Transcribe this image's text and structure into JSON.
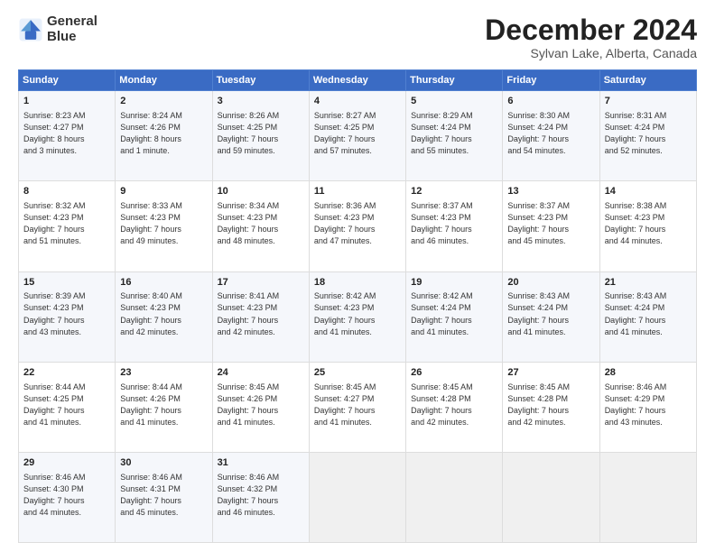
{
  "header": {
    "logo_line1": "General",
    "logo_line2": "Blue",
    "month": "December 2024",
    "location": "Sylvan Lake, Alberta, Canada"
  },
  "days_of_week": [
    "Sunday",
    "Monday",
    "Tuesday",
    "Wednesday",
    "Thursday",
    "Friday",
    "Saturday"
  ],
  "weeks": [
    [
      {
        "day": 1,
        "lines": [
          "Sunrise: 8:23 AM",
          "Sunset: 4:27 PM",
          "Daylight: 8 hours",
          "and 3 minutes."
        ]
      },
      {
        "day": 2,
        "lines": [
          "Sunrise: 8:24 AM",
          "Sunset: 4:26 PM",
          "Daylight: 8 hours",
          "and 1 minute."
        ]
      },
      {
        "day": 3,
        "lines": [
          "Sunrise: 8:26 AM",
          "Sunset: 4:25 PM",
          "Daylight: 7 hours",
          "and 59 minutes."
        ]
      },
      {
        "day": 4,
        "lines": [
          "Sunrise: 8:27 AM",
          "Sunset: 4:25 PM",
          "Daylight: 7 hours",
          "and 57 minutes."
        ]
      },
      {
        "day": 5,
        "lines": [
          "Sunrise: 8:29 AM",
          "Sunset: 4:24 PM",
          "Daylight: 7 hours",
          "and 55 minutes."
        ]
      },
      {
        "day": 6,
        "lines": [
          "Sunrise: 8:30 AM",
          "Sunset: 4:24 PM",
          "Daylight: 7 hours",
          "and 54 minutes."
        ]
      },
      {
        "day": 7,
        "lines": [
          "Sunrise: 8:31 AM",
          "Sunset: 4:24 PM",
          "Daylight: 7 hours",
          "and 52 minutes."
        ]
      }
    ],
    [
      {
        "day": 8,
        "lines": [
          "Sunrise: 8:32 AM",
          "Sunset: 4:23 PM",
          "Daylight: 7 hours",
          "and 51 minutes."
        ]
      },
      {
        "day": 9,
        "lines": [
          "Sunrise: 8:33 AM",
          "Sunset: 4:23 PM",
          "Daylight: 7 hours",
          "and 49 minutes."
        ]
      },
      {
        "day": 10,
        "lines": [
          "Sunrise: 8:34 AM",
          "Sunset: 4:23 PM",
          "Daylight: 7 hours",
          "and 48 minutes."
        ]
      },
      {
        "day": 11,
        "lines": [
          "Sunrise: 8:36 AM",
          "Sunset: 4:23 PM",
          "Daylight: 7 hours",
          "and 47 minutes."
        ]
      },
      {
        "day": 12,
        "lines": [
          "Sunrise: 8:37 AM",
          "Sunset: 4:23 PM",
          "Daylight: 7 hours",
          "and 46 minutes."
        ]
      },
      {
        "day": 13,
        "lines": [
          "Sunrise: 8:37 AM",
          "Sunset: 4:23 PM",
          "Daylight: 7 hours",
          "and 45 minutes."
        ]
      },
      {
        "day": 14,
        "lines": [
          "Sunrise: 8:38 AM",
          "Sunset: 4:23 PM",
          "Daylight: 7 hours",
          "and 44 minutes."
        ]
      }
    ],
    [
      {
        "day": 15,
        "lines": [
          "Sunrise: 8:39 AM",
          "Sunset: 4:23 PM",
          "Daylight: 7 hours",
          "and 43 minutes."
        ]
      },
      {
        "day": 16,
        "lines": [
          "Sunrise: 8:40 AM",
          "Sunset: 4:23 PM",
          "Daylight: 7 hours",
          "and 42 minutes."
        ]
      },
      {
        "day": 17,
        "lines": [
          "Sunrise: 8:41 AM",
          "Sunset: 4:23 PM",
          "Daylight: 7 hours",
          "and 42 minutes."
        ]
      },
      {
        "day": 18,
        "lines": [
          "Sunrise: 8:42 AM",
          "Sunset: 4:23 PM",
          "Daylight: 7 hours",
          "and 41 minutes."
        ]
      },
      {
        "day": 19,
        "lines": [
          "Sunrise: 8:42 AM",
          "Sunset: 4:24 PM",
          "Daylight: 7 hours",
          "and 41 minutes."
        ]
      },
      {
        "day": 20,
        "lines": [
          "Sunrise: 8:43 AM",
          "Sunset: 4:24 PM",
          "Daylight: 7 hours",
          "and 41 minutes."
        ]
      },
      {
        "day": 21,
        "lines": [
          "Sunrise: 8:43 AM",
          "Sunset: 4:24 PM",
          "Daylight: 7 hours",
          "and 41 minutes."
        ]
      }
    ],
    [
      {
        "day": 22,
        "lines": [
          "Sunrise: 8:44 AM",
          "Sunset: 4:25 PM",
          "Daylight: 7 hours",
          "and 41 minutes."
        ]
      },
      {
        "day": 23,
        "lines": [
          "Sunrise: 8:44 AM",
          "Sunset: 4:26 PM",
          "Daylight: 7 hours",
          "and 41 minutes."
        ]
      },
      {
        "day": 24,
        "lines": [
          "Sunrise: 8:45 AM",
          "Sunset: 4:26 PM",
          "Daylight: 7 hours",
          "and 41 minutes."
        ]
      },
      {
        "day": 25,
        "lines": [
          "Sunrise: 8:45 AM",
          "Sunset: 4:27 PM",
          "Daylight: 7 hours",
          "and 41 minutes."
        ]
      },
      {
        "day": 26,
        "lines": [
          "Sunrise: 8:45 AM",
          "Sunset: 4:28 PM",
          "Daylight: 7 hours",
          "and 42 minutes."
        ]
      },
      {
        "day": 27,
        "lines": [
          "Sunrise: 8:45 AM",
          "Sunset: 4:28 PM",
          "Daylight: 7 hours",
          "and 42 minutes."
        ]
      },
      {
        "day": 28,
        "lines": [
          "Sunrise: 8:46 AM",
          "Sunset: 4:29 PM",
          "Daylight: 7 hours",
          "and 43 minutes."
        ]
      }
    ],
    [
      {
        "day": 29,
        "lines": [
          "Sunrise: 8:46 AM",
          "Sunset: 4:30 PM",
          "Daylight: 7 hours",
          "and 44 minutes."
        ]
      },
      {
        "day": 30,
        "lines": [
          "Sunrise: 8:46 AM",
          "Sunset: 4:31 PM",
          "Daylight: 7 hours",
          "and 45 minutes."
        ]
      },
      {
        "day": 31,
        "lines": [
          "Sunrise: 8:46 AM",
          "Sunset: 4:32 PM",
          "Daylight: 7 hours",
          "and 46 minutes."
        ]
      },
      null,
      null,
      null,
      null
    ]
  ]
}
